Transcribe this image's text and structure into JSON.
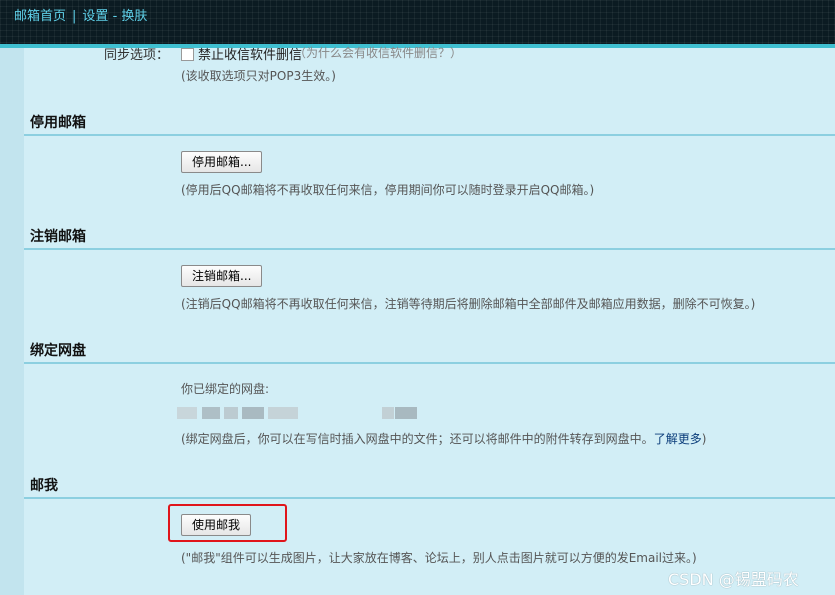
{
  "topbar": {
    "home_link": "邮箱首页",
    "settings_link": "设置",
    "dash": "-",
    "skin_link": "换肤"
  },
  "sync": {
    "label": "同步选项：",
    "checkbox_label": "禁止收信软件删信",
    "checkbox_hint": "（为什么会有收信软件删信？）",
    "note": "(该收取选项只对POP3生效。)"
  },
  "sections": {
    "disable": {
      "title": "停用邮箱",
      "button": "停用邮箱...",
      "note": "(停用后QQ邮箱将不再收取任何来信，停用期间你可以随时登录开启QQ邮箱。)"
    },
    "cancel": {
      "title": "注销邮箱",
      "button": "注销邮箱...",
      "note": "(注销后QQ邮箱将不再收取任何来信，注销等待期后将删除邮箱中全部邮件及邮箱应用数据，删除不可恢复。)"
    },
    "netdisk": {
      "title": "绑定网盘",
      "bound_label": "你已绑定的网盘:",
      "note_prefix": "(绑定网盘后，你可以在写信时插入网盘中的文件；还可以将邮件中的附件转存到网盘中。",
      "learn_more": "了解更多",
      "note_suffix": ")"
    },
    "mailme": {
      "title": "邮我",
      "button": "使用邮我",
      "note": "(\"邮我\"组件可以生成图片，让大家放在博客、论坛上，别人点击图片就可以方便的发Email过来。)"
    }
  },
  "watermark": "CSDN @锡盟码农"
}
